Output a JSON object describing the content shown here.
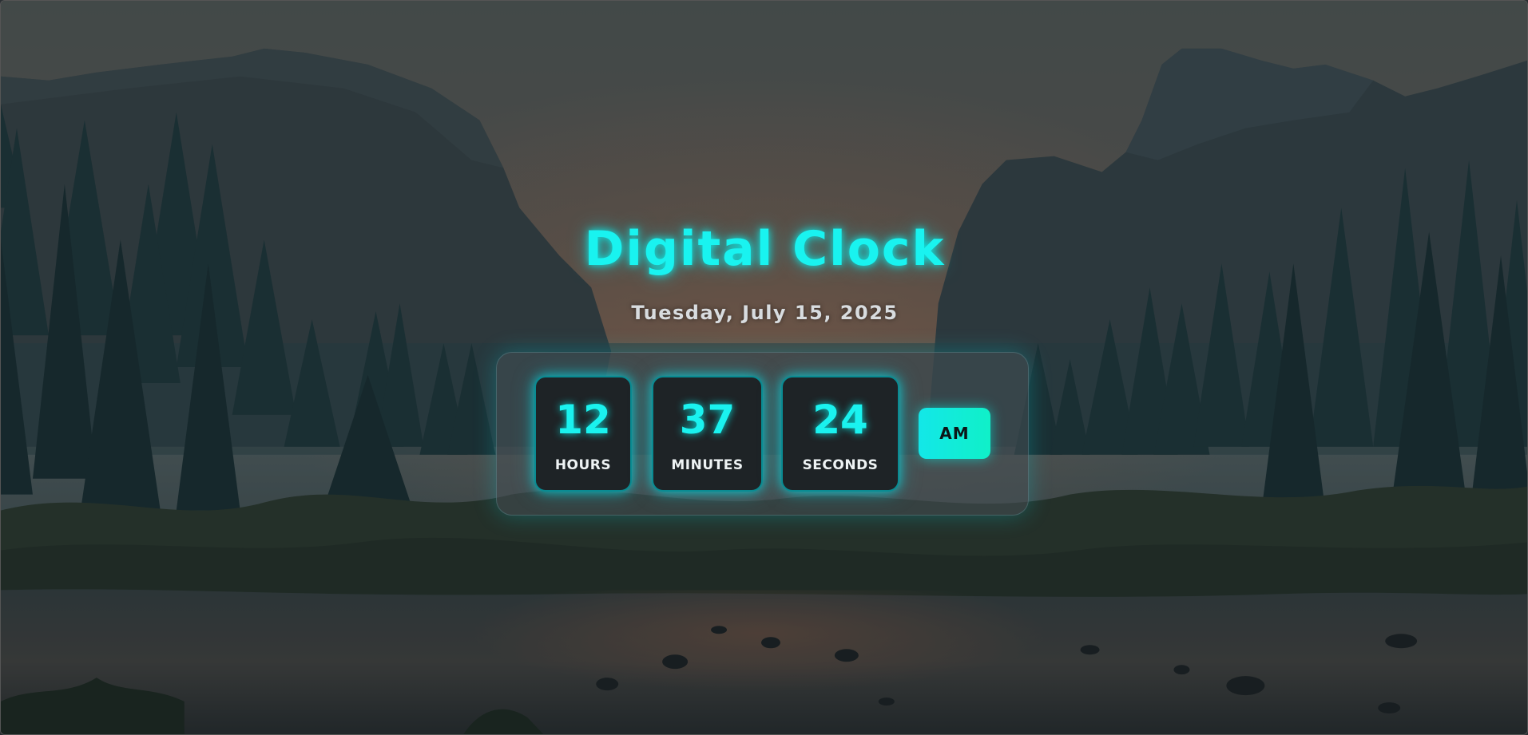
{
  "app": {
    "title": "Digital Clock",
    "date": "Tuesday, July 15, 2025"
  },
  "clock": {
    "hours": "12",
    "hours_label": "HOURS",
    "minutes": "37",
    "minutes_label": "MINUTES",
    "seconds": "24",
    "seconds_label": "SECONDS",
    "period": "AM"
  },
  "colors": {
    "accent": "#19f3f0",
    "panel_background": "#1e2326",
    "period_gradient_start": "#13e7e8",
    "period_gradient_end": "#10f0c8"
  },
  "background": {
    "image": "landscape-valley-river-forest"
  }
}
